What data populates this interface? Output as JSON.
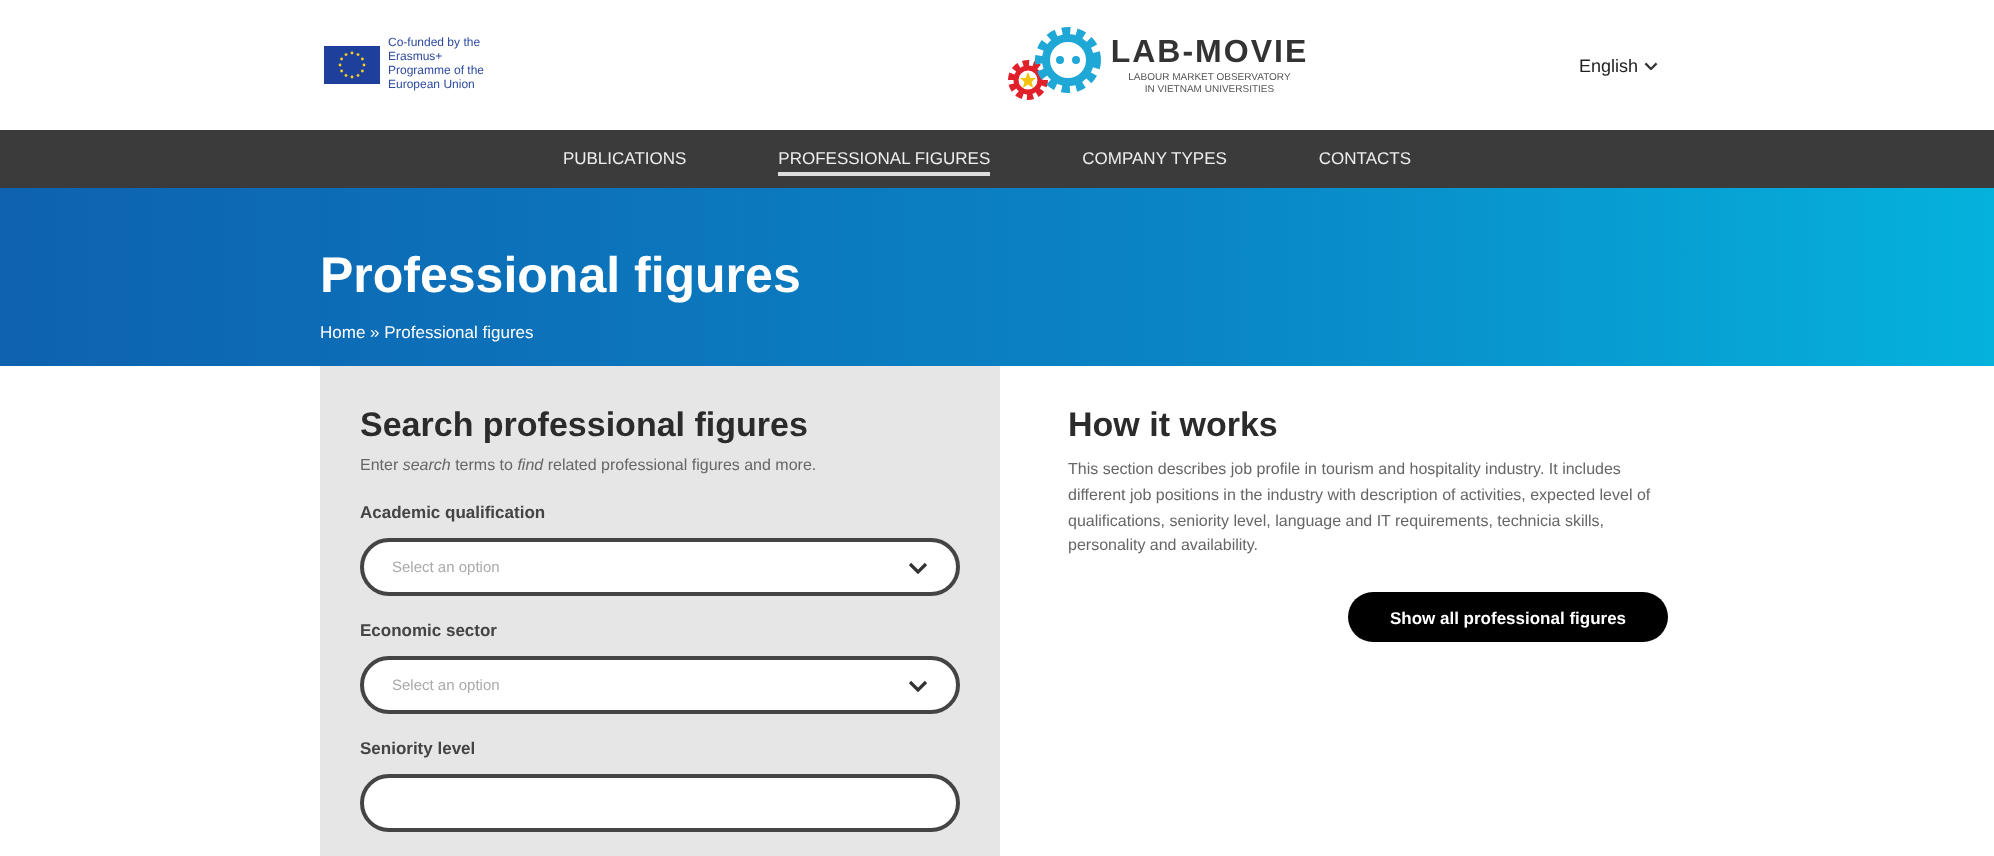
{
  "header": {
    "eu_text": "Co-funded by the Erasmus+ Programme of the European Union",
    "logo_title": "LAB-MOVIE",
    "logo_subtitle_1": "LABOUR MARKET OBSERVATORY",
    "logo_subtitle_2": "IN VIETNAM UNIVERSITIES",
    "language": "English"
  },
  "nav": [
    {
      "label": "PUBLICATIONS",
      "selected": false
    },
    {
      "label": "PROFESSIONAL FIGURES",
      "selected": true
    },
    {
      "label": "COMPANY TYPES",
      "selected": false
    },
    {
      "label": "CONTACTS",
      "selected": false
    }
  ],
  "hero": {
    "title": "Professional figures",
    "breadcrumb": "Home » Professional figures"
  },
  "search": {
    "title": "Search professional figures",
    "intro": "Enter *search* terms to *find* related professional figures and more.",
    "fields": [
      {
        "label": "Academic qualification",
        "placeholder": "Select an option"
      },
      {
        "label": "Economic sector",
        "placeholder": "Select an option"
      },
      {
        "label": "Seniority level"
      }
    ]
  },
  "how": {
    "title": "How it works",
    "text": "This section describes job profile in tourism and hospitality industry. It includes different job positions in the industry with description of activities, expected level of qualifications, seniority level, language and IT requirements, technicia skills, personality and availability.",
    "button": "Show all professional figures"
  }
}
